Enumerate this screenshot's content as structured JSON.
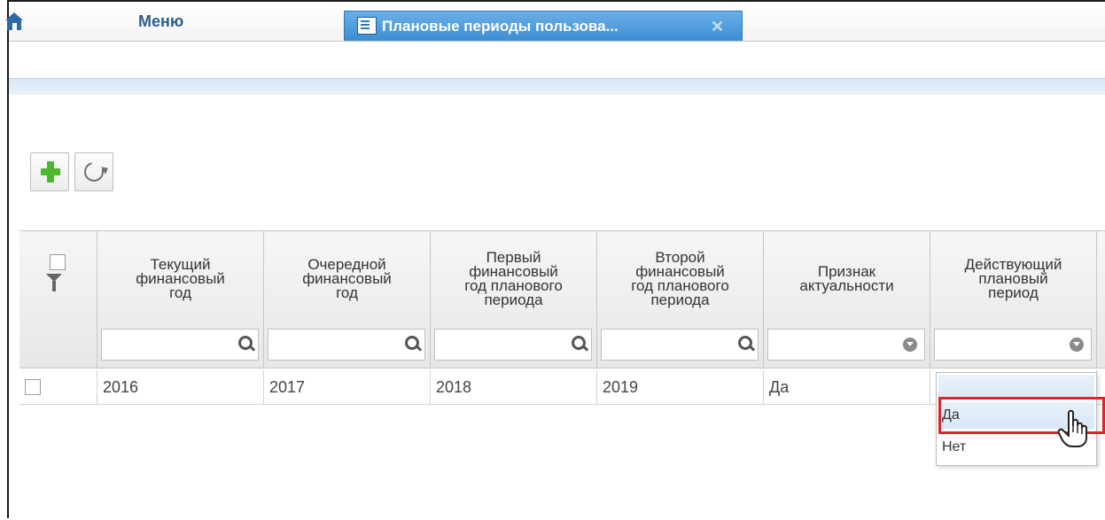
{
  "topbar": {
    "menu_label": "Меню",
    "tab": {
      "title": "Плановые периоды пользова...",
      "close": "✕"
    }
  },
  "toolbar": {
    "add_icon": "plus-icon",
    "refresh_icon": "refresh-icon"
  },
  "grid": {
    "columns": [
      "Текущий\nфинансовый\nгод",
      "Очередной\nфинансовый\nгод",
      "Первый\nфинансовый\nгод планового\nпериода",
      "Второй\nфинансовый\nгод планового\nпериода",
      "Признак\nактуальности",
      "Действующий\nплановый\nпериод"
    ],
    "rows": [
      {
        "c1": "2016",
        "c2": "2017",
        "c3": "2018",
        "c4": "2019",
        "c5": "Да",
        "c6": ""
      }
    ]
  },
  "dropdown": {
    "options": [
      "Да",
      "Нет"
    ],
    "hovered": "Да"
  },
  "colors": {
    "tab_bg": "#3d8dd1",
    "menu_text": "#2d5e8f",
    "highlight": "#e0232a",
    "plus": "#4cb82f"
  }
}
